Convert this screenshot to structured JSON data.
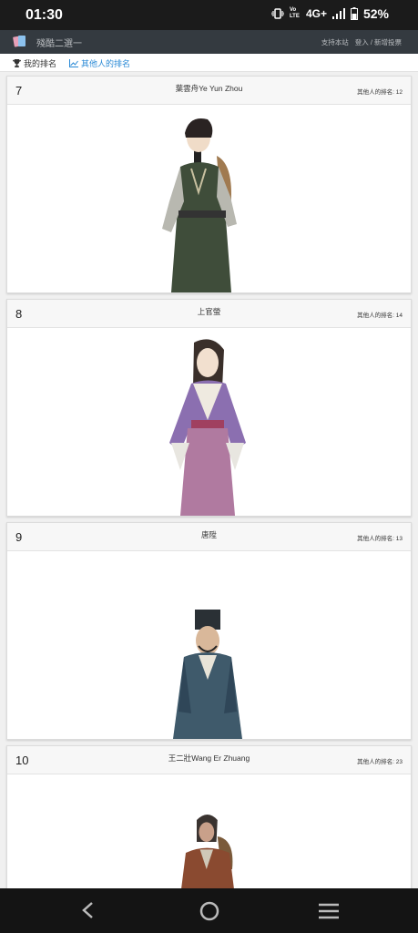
{
  "status": {
    "time": "01:30",
    "network": "4G+",
    "battery": "52%",
    "volte": "Vo LTE"
  },
  "navbar": {
    "brand": "殘酷二選一",
    "support": "支持本站",
    "login": "登入 / 新增投票"
  },
  "tabs": {
    "mine": "我的排名",
    "others": "其他人的排名"
  },
  "cards": [
    {
      "rank": "7",
      "name": "葉雲舟Ye Yun Zhou",
      "others": "其他人的排名: 12"
    },
    {
      "rank": "8",
      "name": "上官螢",
      "others": "其他人的排名: 14"
    },
    {
      "rank": "9",
      "name": "唐陞",
      "others": "其他人的排名: 13"
    },
    {
      "rank": "10",
      "name": "王二壯Wang Er Zhuang",
      "others": "其他人的排名: 23"
    }
  ],
  "colors": {
    "navbar": "#343a40",
    "link": "#2a8ad6",
    "statusbar": "#1b1b1b"
  }
}
